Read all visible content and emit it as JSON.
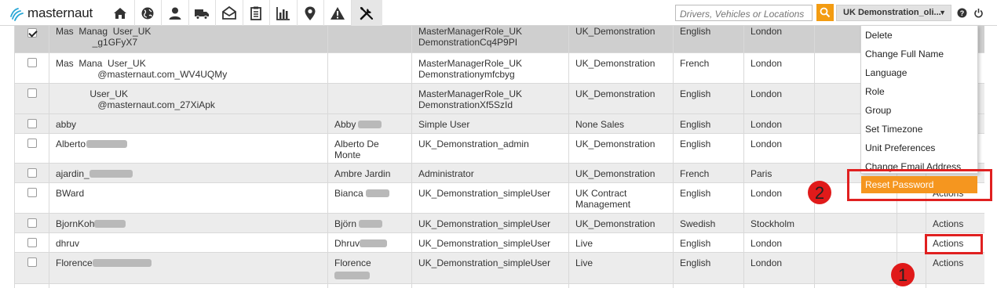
{
  "app": {
    "logo_text": "masternaut"
  },
  "nav": {
    "items": [
      "home-icon",
      "globe-icon",
      "user-icon",
      "truck-icon",
      "envelope-icon",
      "clipboard-icon",
      "bar-chart-icon",
      "map-pin-icon",
      "warning-icon",
      "tools-icon"
    ],
    "active": "tools-icon"
  },
  "search": {
    "placeholder": "Drivers, Vehicles or Locations"
  },
  "account": {
    "label": "UK Demonstration_oli..."
  },
  "colors": {
    "accent": "#f5961f",
    "annotation": "#e02020"
  },
  "rows": [
    {
      "checked": true,
      "name_l1": "Mas  Manag  User_UK",
      "name_l2": "              _g1GFyX7",
      "full_name": "",
      "role_l1": "MasterManagerRole_UK",
      "role_l2": "DemonstrationCq4P9PI",
      "group": "UK_Demonstration",
      "group_l2": "",
      "language": "English",
      "timezone": "London",
      "action": ""
    },
    {
      "checked": false,
      "name_l1": "Mas  Mana  User_UK",
      "name_l2": "                @masternaut.com_WV4UQMy",
      "full_name": "",
      "role_l1": "MasterManagerRole_UK",
      "role_l2": "Demonstrationymfcbyg",
      "group": "UK_Demonstration",
      "group_l2": "",
      "language": "French",
      "timezone": "London",
      "action": ""
    },
    {
      "checked": false,
      "name_l1": "             User_UK",
      "name_l2": "                @masternaut.com_27XiApk",
      "full_name": "",
      "role_l1": "MasterManagerRole_UK",
      "role_l2": "DemonstrationXf5SzId",
      "group": "UK_Demonstration",
      "group_l2": "",
      "language": "English",
      "timezone": "London",
      "action": ""
    },
    {
      "checked": false,
      "name_l1": "abby",
      "name_l2": "",
      "full_name": "Abby",
      "role_l1": "Simple User",
      "role_l2": "",
      "group": "None Sales",
      "group_l2": "",
      "language": "English",
      "timezone": "London",
      "action": ""
    },
    {
      "checked": false,
      "name_l1": "Alberto",
      "name_l2": "",
      "full_name": "Alberto De",
      "full_name_l2": "Monte",
      "role_l1": "UK_Demonstration_admin",
      "role_l2": "",
      "group": "UK_Demonstration",
      "group_l2": "",
      "language": "English",
      "timezone": "London",
      "action": ""
    },
    {
      "checked": false,
      "name_l1": "ajardin_",
      "name_l2": "",
      "full_name": "Ambre Jardin",
      "role_l1": "Administrator",
      "role_l2": "",
      "group": "UK_Demonstration",
      "group_l2": "",
      "language": "French",
      "timezone": "Paris",
      "action": ""
    },
    {
      "checked": false,
      "name_l1": "BWard",
      "name_l2": "",
      "full_name": "Bianca",
      "role_l1": "UK_Demonstration_simpleUser",
      "role_l2": "",
      "group": "UK Contract",
      "group_l2": "Management",
      "language": "English",
      "timezone": "London",
      "action": "Actions"
    },
    {
      "checked": false,
      "name_l1": "BjornKoh",
      "name_l2": "",
      "full_name": "Björn",
      "role_l1": "UK_Demonstration_simpleUser",
      "role_l2": "",
      "group": "UK_Demonstration",
      "group_l2": "",
      "language": "Swedish",
      "timezone": "Stockholm",
      "action": "Actions"
    },
    {
      "checked": false,
      "name_l1": "dhruv",
      "name_l2": "",
      "full_name": "Dhruv",
      "role_l1": "UK_Demonstration_simpleUser",
      "role_l2": "",
      "group": "Live",
      "group_l2": "",
      "language": "English",
      "timezone": "London",
      "action": "Actions"
    },
    {
      "checked": false,
      "name_l1": "Florence",
      "name_l2": "",
      "full_name": "Florence",
      "role_l1": "UK_Demonstration_simpleUser",
      "role_l2": "",
      "group": "Live",
      "group_l2": "",
      "language": "English",
      "timezone": "London",
      "action": "Actions"
    }
  ],
  "menu": {
    "items": [
      "Delete",
      "Change Full Name",
      "Language",
      "Role",
      "Group",
      "Set Timezone",
      "Unit Preferences",
      "Change Email Address"
    ],
    "reset_password": "Reset Password"
  },
  "annotations": {
    "one": "1",
    "two": "2"
  }
}
